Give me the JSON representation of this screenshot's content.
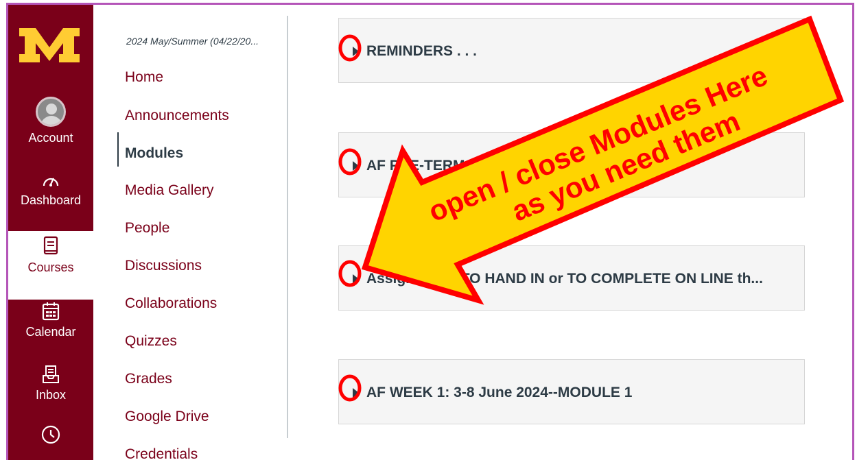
{
  "global_nav": {
    "account": "Account",
    "dashboard": "Dashboard",
    "courses": "Courses",
    "calendar": "Calendar",
    "inbox": "Inbox"
  },
  "course_nav": {
    "term": "2024 May/Summer (04/22/20...",
    "items": [
      "Home",
      "Announcements",
      "Modules",
      "Media Gallery",
      "People",
      "Discussions",
      "Collaborations",
      "Quizzes",
      "Grades",
      "Google Drive",
      "Credentials"
    ],
    "active": "Modules"
  },
  "modules": [
    {
      "title": "REMINDERS . . ."
    },
    {
      "title": "AF PRE-TERM su2"
    },
    {
      "title": "Assignments TO HAND IN or TO COMPLETE ON LINE th..."
    },
    {
      "title": "AF WEEK 1: 3-8 June 2024--MODULE 1"
    }
  ],
  "callout": {
    "line1": "open / close Modules Here",
    "line2": "as you need them",
    "fill": "#ffd400",
    "stroke": "#ff0000"
  },
  "colors": {
    "nav_bg": "#7a0019",
    "brand_gold": "#ffcc33",
    "highlight": "#ff0000",
    "frame": "#b455b8"
  }
}
